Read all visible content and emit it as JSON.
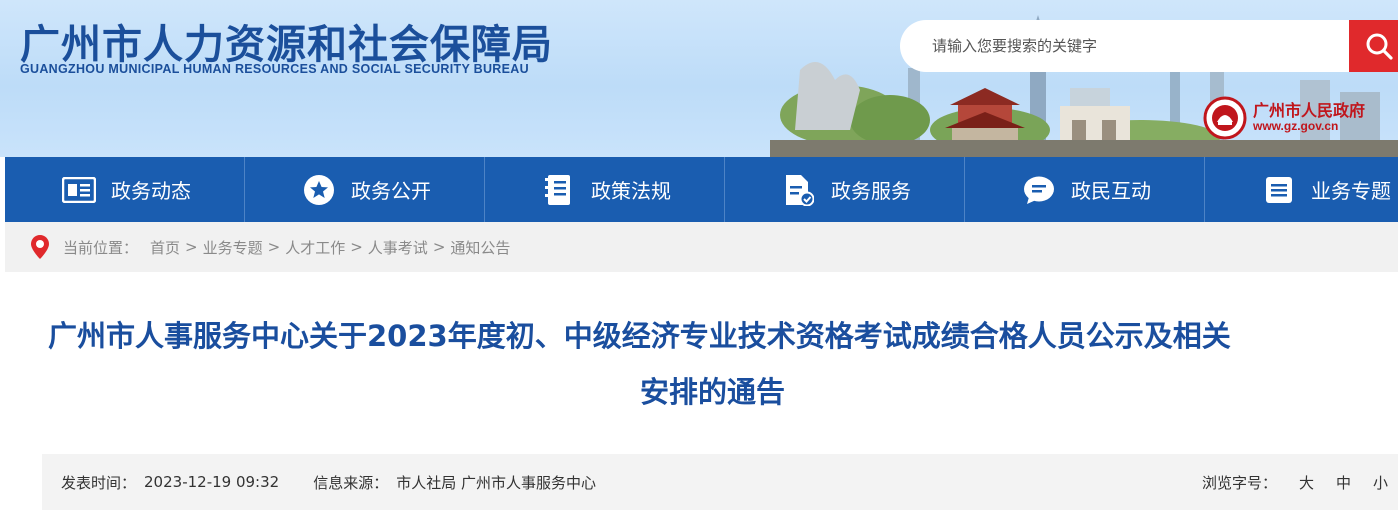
{
  "header": {
    "logo_cn": "广州市人力资源和社会保障局",
    "logo_en": "GUANGZHOU MUNICIPAL HUMAN RESOURCES AND SOCIAL SECURITY BUREAU",
    "search_placeholder": "请输入您要搜索的关键字",
    "gov_name": "广州市人民政府",
    "gov_url": "www.gz.gov.cn"
  },
  "nav": {
    "items": [
      {
        "label": "政务动态",
        "icon": "news-icon"
      },
      {
        "label": "政务公开",
        "icon": "star-icon"
      },
      {
        "label": "政策法规",
        "icon": "book-icon"
      },
      {
        "label": "政务服务",
        "icon": "document-icon"
      },
      {
        "label": "政民互动",
        "icon": "chat-icon"
      },
      {
        "label": "业务专题",
        "icon": "list-icon"
      }
    ]
  },
  "breadcrumb": {
    "prefix": "当前位置：",
    "items": [
      "首页",
      "业务专题",
      "人才工作",
      "人事考试",
      "通知公告"
    ],
    "separator": ">"
  },
  "article": {
    "title_line1": "广州市人事服务中心关于2023年度初、中级经济专业技术资格考试成绩合格人员公示及相关",
    "title_line2": "安排的通告"
  },
  "meta": {
    "publish_label": "发表时间：",
    "publish_time": "2023-12-19 09:32",
    "source_label": "信息来源：",
    "source_value": "市人社局 广州市人事服务中心",
    "font_size_label": "浏览字号：",
    "font_large": "大",
    "font_medium": "中",
    "font_small": "小"
  },
  "colors": {
    "brand_blue": "#1a5db0",
    "title_blue": "#1a4e9e",
    "search_red": "#e0292c",
    "gov_red": "#c0161c"
  }
}
